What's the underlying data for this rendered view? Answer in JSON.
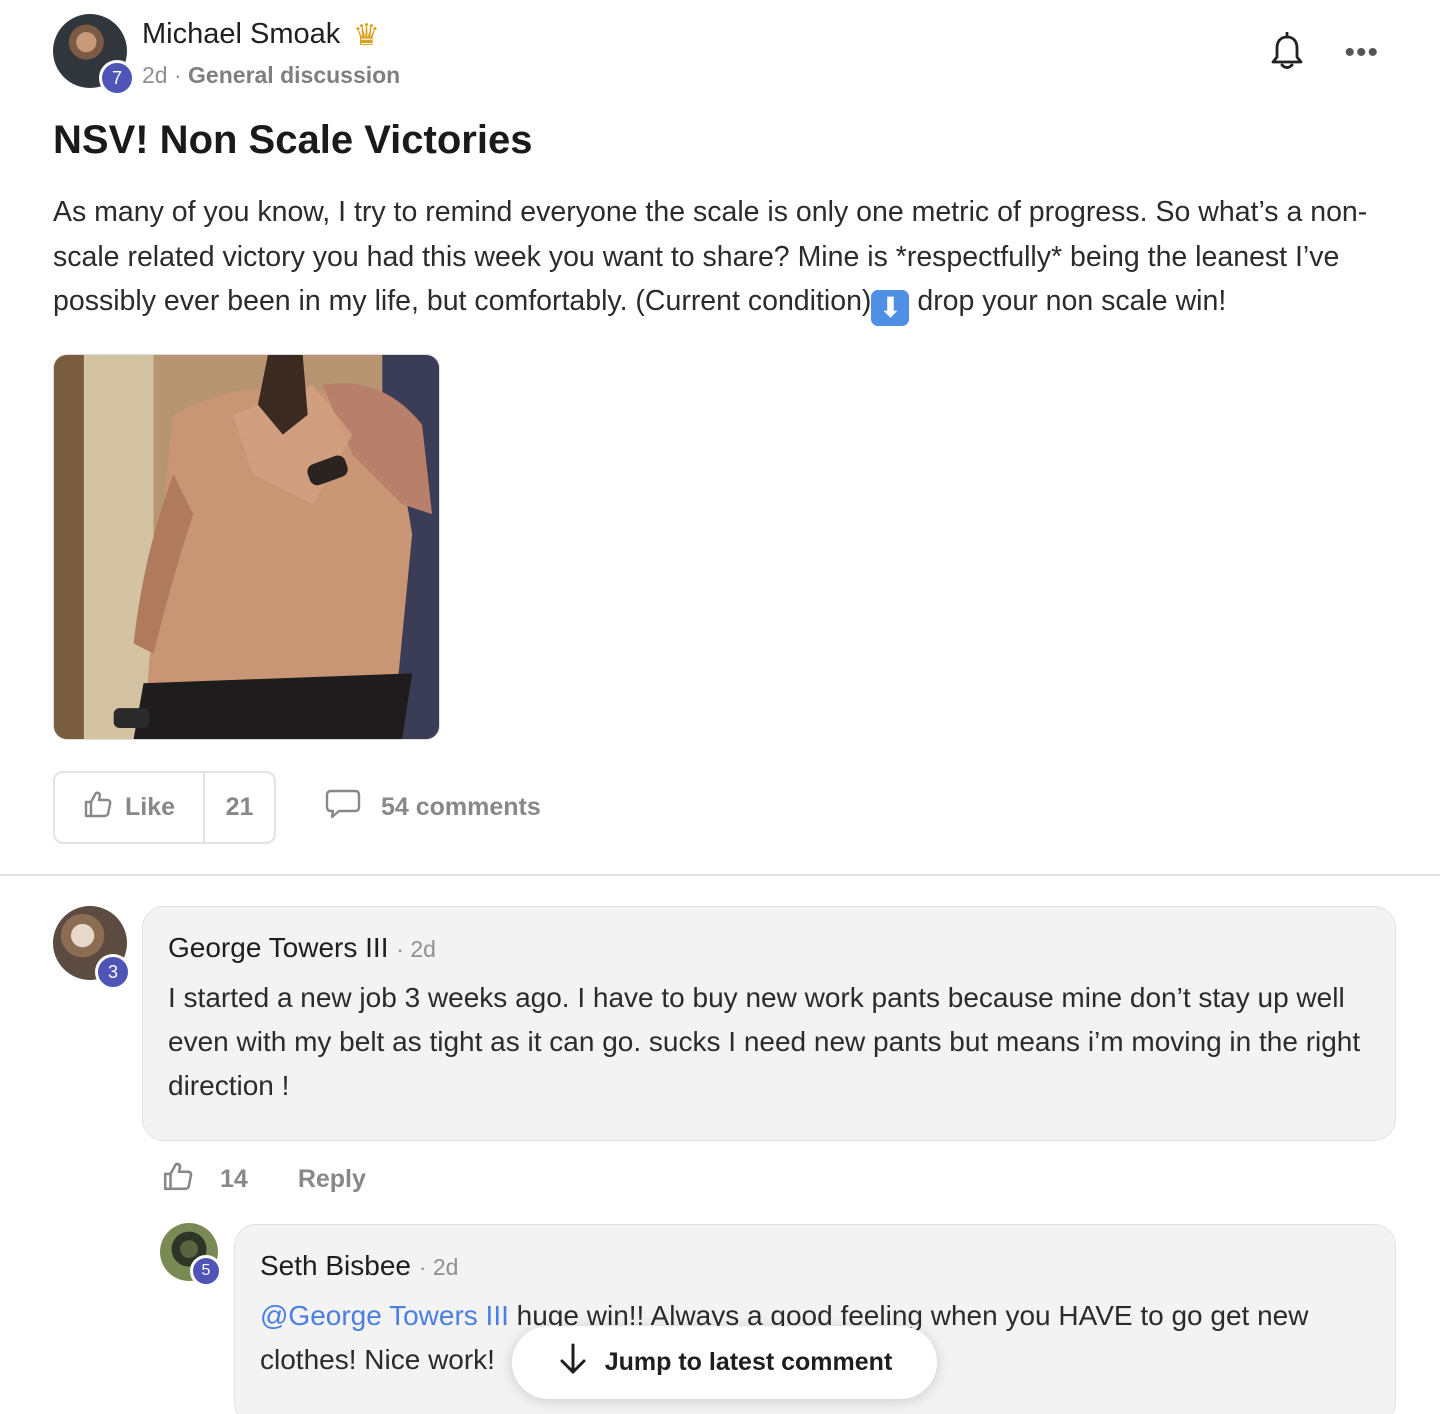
{
  "post": {
    "author": "Michael Smoak",
    "author_level": "7",
    "age": "2d",
    "separator": "·",
    "category": "General discussion",
    "title": "NSV! Non Scale Victories",
    "body_before_emoji": "As many of you know, I try to remind everyone the scale is only one metric of progress. So what’s a non-scale related victory you had this week you want to share? Mine is *respectfully* being the leanest I’ve possibly ever been in my life, but comfortably. (Current condition)",
    "emoji_glyph": "⬇",
    "body_after_emoji": " drop your non scale win!",
    "like_label": "Like",
    "like_count": "21",
    "comments_label": "54 comments"
  },
  "icons": {
    "crown": "crown-icon",
    "bell": "bell-icon",
    "more": "more-icon",
    "like": "thumbs-up-icon",
    "comment": "comment-bubble-icon",
    "jump": "arrow-down-icon"
  },
  "comments": [
    {
      "author": "George Towers III",
      "level": "3",
      "time": "2d",
      "text": "I started a new job 3 weeks ago. I have to buy new work pants because mine don’t stay up well even with my belt as tight as it can go. sucks I need new pants but means i’m moving in the right direction !",
      "likes": "14",
      "reply_label": "Reply"
    },
    {
      "author": "Seth Bisbee",
      "level": "5",
      "time": "2d",
      "mention": "@George Towers III",
      "text": " huge win!! Always a good feeling when you HAVE to go get new clothes! Nice work!"
    }
  ],
  "jump_label": "Jump to latest comment",
  "colors": {
    "badge": "#4e55b6",
    "mention": "#4a7fe0",
    "muted": "#888888",
    "crown": "#d7a21c"
  }
}
